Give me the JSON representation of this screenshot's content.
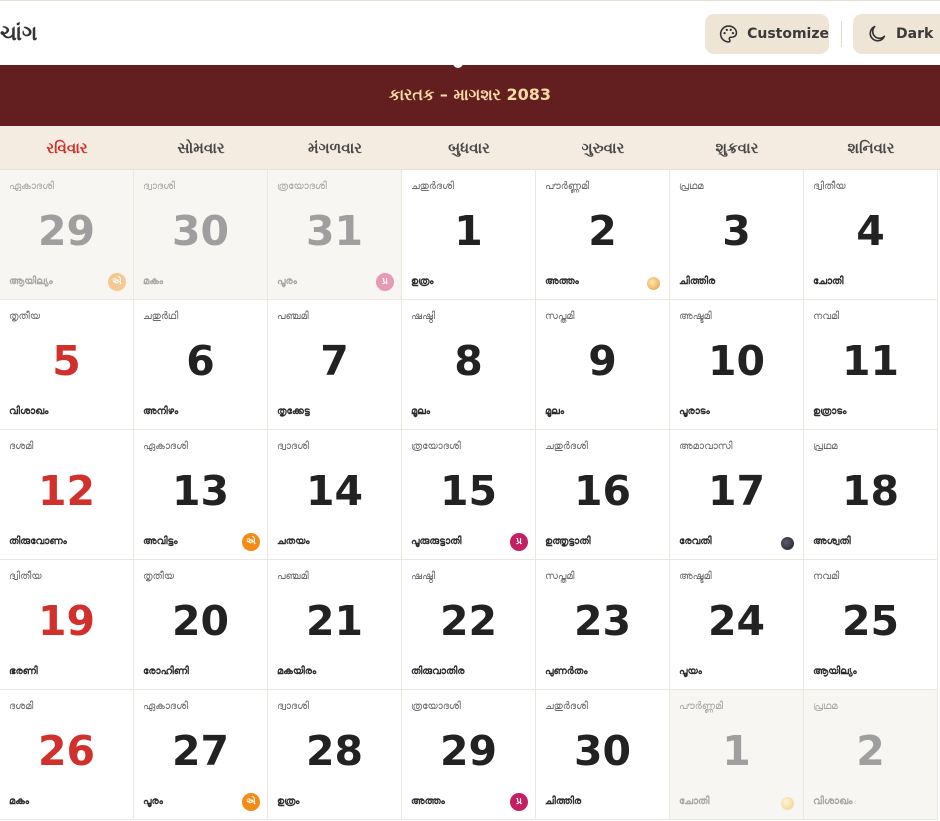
{
  "app": {
    "brand_text": "ચાંગ"
  },
  "toolbar": {
    "customize_label": "Customize",
    "dark_label": "Dark"
  },
  "calendar": {
    "title": "કારતક – માગશર 2083",
    "weekdays": [
      "રવિવાર",
      "સોમવાર",
      "મંગળવાર",
      "બુધવાર",
      "ગુરુવાર",
      "શુક્રવાર",
      "શનિવાર"
    ],
    "weeks": [
      [
        {
          "tithi": "ഏകാദശി",
          "day": "29",
          "star": "ആയില്യം",
          "muted": true,
          "badge": {
            "glyph": "એ",
            "color": "orange"
          }
        },
        {
          "tithi": "ദ്വാദശി",
          "day": "30",
          "star": "മകം",
          "muted": true
        },
        {
          "tithi": "ത്രയോദശി",
          "day": "31",
          "star": "പൂരം",
          "muted": true,
          "badge": {
            "glyph": "પ્ર",
            "color": "magenta"
          }
        },
        {
          "tithi": "ചതുർദശി",
          "day": "1",
          "star": "ഉത്രം"
        },
        {
          "tithi": "പൗർണ്ണമി",
          "day": "2",
          "star": "അത്തം",
          "moon": "full"
        },
        {
          "tithi": "പ്രഥമ",
          "day": "3",
          "star": "ചിത്തിര"
        },
        {
          "tithi": "ദ്വിതീയ",
          "day": "4",
          "star": "ചോതി"
        }
      ],
      [
        {
          "tithi": "തൃതീയ",
          "day": "5",
          "star": "വിശാഖം"
        },
        {
          "tithi": "ചതുർഥി",
          "day": "6",
          "star": "അനിഴം"
        },
        {
          "tithi": "പഞ്ചമി",
          "day": "7",
          "star": "തൃക്കേട്ട"
        },
        {
          "tithi": "ഷഷ്ഠി",
          "day": "8",
          "star": "മൂലം"
        },
        {
          "tithi": "സപ്തമി",
          "day": "9",
          "star": "മൂലം"
        },
        {
          "tithi": "അഷ്ടമി",
          "day": "10",
          "star": "പൂരാടം"
        },
        {
          "tithi": "നവമി",
          "day": "11",
          "star": "ഉത്രാടം"
        }
      ],
      [
        {
          "tithi": "ദശമി",
          "day": "12",
          "star": "തിരുവോണം"
        },
        {
          "tithi": "ഏകാദശി",
          "day": "13",
          "star": "അവിട്ടം",
          "badge": {
            "glyph": "એ",
            "color": "orange"
          }
        },
        {
          "tithi": "ദ്വാദശി",
          "day": "14",
          "star": "ചതയം"
        },
        {
          "tithi": "ത്രയോദശി",
          "day": "15",
          "star": "പൂരുരുട്ടാതി",
          "badge": {
            "glyph": "પ્ર",
            "color": "magenta"
          }
        },
        {
          "tithi": "ചതുർദശി",
          "day": "16",
          "star": "ഉത്തൃട്ടാതി"
        },
        {
          "tithi": "അമാവാസി",
          "day": "17",
          "star": "രേവതി",
          "moon": "new"
        },
        {
          "tithi": "പ്രഥമ",
          "day": "18",
          "star": "അശ്വതി"
        }
      ],
      [
        {
          "tithi": "ദ്വിതീയ",
          "day": "19",
          "star": "ഭരണി"
        },
        {
          "tithi": "തൃതീയ",
          "day": "20",
          "star": "രോഹിണി"
        },
        {
          "tithi": "പഞ്ചമി",
          "day": "21",
          "star": "മകയിരം"
        },
        {
          "tithi": "ഷഷ്ഠി",
          "day": "22",
          "star": "തിരുവാതിര"
        },
        {
          "tithi": "സപ്തമി",
          "day": "23",
          "star": "പുണർതം"
        },
        {
          "tithi": "അഷ്ടമി",
          "day": "24",
          "star": "പൂയം"
        },
        {
          "tithi": "നവമി",
          "day": "25",
          "star": "ആയില്യം"
        }
      ],
      [
        {
          "tithi": "ദശമി",
          "day": "26",
          "star": "മകം"
        },
        {
          "tithi": "ഏകാദശി",
          "day": "27",
          "star": "പൂരം",
          "badge": {
            "glyph": "એ",
            "color": "orange"
          }
        },
        {
          "tithi": "ദ്വാദശി",
          "day": "28",
          "star": "ഉത്രം"
        },
        {
          "tithi": "ത്രയോദശി",
          "day": "29",
          "star": "അത്തം",
          "badge": {
            "glyph": "પ્ર",
            "color": "magenta"
          }
        },
        {
          "tithi": "ചതുർദശി",
          "day": "30",
          "star": "ചിത്തിര"
        },
        {
          "tithi": "പൗർണ്ണമി",
          "day": "1",
          "star": "ചോതി",
          "muted": true,
          "moon": "full"
        },
        {
          "tithi": "പ്രഥമ",
          "day": "2",
          "star": "വിശാഖം",
          "muted": true
        }
      ]
    ]
  }
}
